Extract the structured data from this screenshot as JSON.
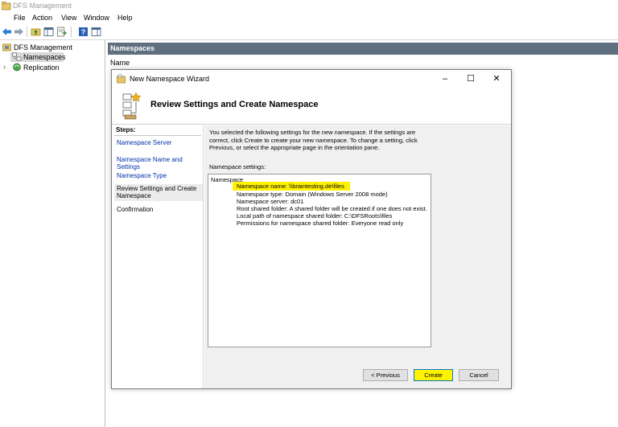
{
  "window": {
    "title": "DFS Management"
  },
  "menu": [
    "File",
    "Action",
    "View",
    "Window",
    "Help"
  ],
  "tree": {
    "root": "DFS Management",
    "items": [
      {
        "label": "Namespaces",
        "selected": true
      },
      {
        "label": "Replication",
        "selected": false
      }
    ]
  },
  "pane": {
    "header": "Namespaces",
    "column": "Name"
  },
  "wizard": {
    "title": "New Namespace Wizard",
    "heading": "Review Settings and Create Namespace",
    "steps_title": "Steps:",
    "steps": [
      {
        "label": "Namespace Server",
        "state": "link"
      },
      {
        "label": "Namespace Name and Settings",
        "state": "link"
      },
      {
        "label": "Namespace Type",
        "state": "link"
      },
      {
        "label": "Review Settings and Create Namespace",
        "state": "current"
      },
      {
        "label": "Confirmation",
        "state": "plain"
      }
    ],
    "description_lines": [
      "You selected the following settings for the new namespace. If the settings are",
      "correct, click Create to create your new namespace. To change a setting, click",
      "Previous, or select the appropriate page in the orientation pane."
    ],
    "settings_label": "Namespace settings:",
    "settings": {
      "heading": "Namespace",
      "lines": [
        "Namespace name:  \\\\braintesting.de\\files",
        "Namespace type:  Domain (Windows Server 2008 mode)",
        "Namespace server:  dc01",
        "Root shared folder:  A shared folder will be created if one does not exist.",
        "Local path of namespace shared folder: C:\\DFSRoots\\files",
        "Permissions for namespace shared folder: Everyone read only"
      ]
    },
    "buttons": {
      "previous": "< Previous",
      "create": "Create",
      "cancel": "Cancel"
    },
    "highlight_color": "#fff200"
  }
}
